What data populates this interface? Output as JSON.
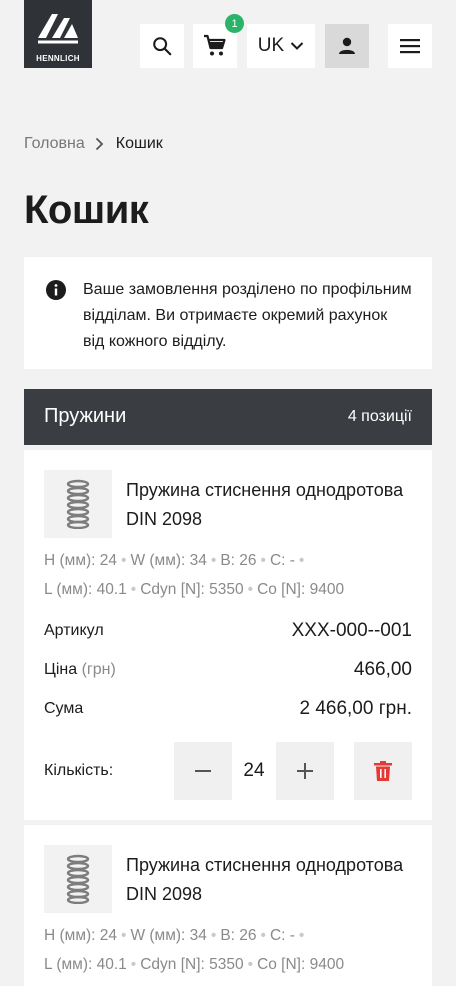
{
  "header": {
    "logo_text": "HENNLICH",
    "cart_count": "1",
    "language": "UK",
    "icons": [
      "search-icon",
      "cart-icon",
      "chevron-down-icon",
      "user-icon",
      "menu-icon"
    ]
  },
  "breadcrumb": {
    "home": "Головна",
    "current": "Кошик"
  },
  "page_title": "Кошик",
  "info": {
    "text": "Ваше замовлення розділено по профільним відділам. Ви отримаєте окремий рахунок від кожного відділу."
  },
  "group": {
    "title": "Пружини",
    "count": "4 позиції"
  },
  "items": [
    {
      "name": "Пружина стиснення однодротова DIN 2098",
      "specs_line1": [
        "H (мм): 24",
        "W (мм): 34",
        "B: 26",
        "C: -"
      ],
      "specs_line2": [
        "L (мм): 40.1",
        "Cdyn [N]: 5350",
        "Co [N]: 9400"
      ],
      "article_label": "Артикул",
      "article": "XXX-000--001",
      "price_label": "Ціна",
      "price_unit": "(грн)",
      "price": "466,00",
      "sum_label": "Сума",
      "sum": "2 466,00 грн.",
      "qty_label": "Кількість:",
      "qty": "24"
    },
    {
      "name": "Пружина стиснення однодротова DIN 2098",
      "specs_line1": [
        "H (мм): 24",
        "W (мм): 34",
        "B: 26",
        "C: -"
      ],
      "specs_line2": [
        "L (мм): 40.1",
        "Cdyn [N]: 5350",
        "Co [N]: 9400"
      ]
    }
  ],
  "colors": {
    "header_dark": "#3a3d42",
    "badge": "#2bb36a",
    "delete": "#e53935",
    "background": "#f2f2f2"
  }
}
